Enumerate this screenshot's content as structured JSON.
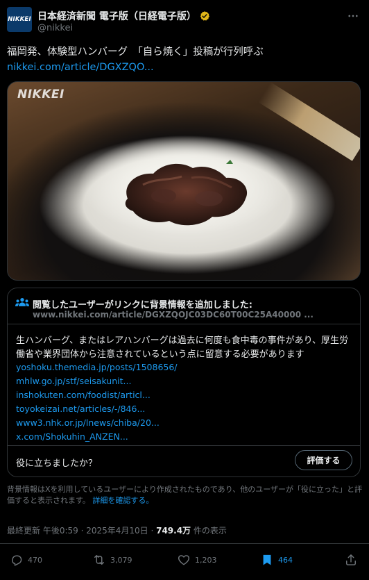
{
  "author": {
    "display_name": "日本経済新聞 電子版（日経電子版）",
    "handle": "@nikkei",
    "avatar_text": "NIKKEI"
  },
  "tweet": {
    "text": "福岡発、体験型ハンバーグ　「自ら焼く」投稿が行列呼ぶ",
    "link": "nikkei.com/article/DGXZQO..."
  },
  "media": {
    "logo_text": "NIKKEI",
    "icon": "photo-rice-bowl-with-hamburg"
  },
  "community_note": {
    "title": "閲覧したユーザーがリンクに背景情報を追加しました:",
    "url": "www.nikkei.com/article/DGXZQOJC03DC60T00C25A40000 ...",
    "body": "生ハンバーグ、またはレアハンバーグは過去に何度も食中毒の事件があり、厚生労働省や業界団体から注意されているという点に留意する必要があります",
    "sources": [
      "yoshoku.themedia.jp/posts/1508656/",
      "mhlw.go.jp/stf/seisakunit...",
      "inshokuten.com/foodist/articl...",
      "toyokeizai.net/articles/-/846...",
      "www3.nhk.or.jp/lnews/chiba/20...",
      "x.com/Shokuhin_ANZEN..."
    ],
    "helpful_question": "役に立ちましたか？",
    "rate_button": "評価する"
  },
  "disclaimer": {
    "text": "背景情報はXを利用しているユーザーにより作成されたものであり、他のユーザーが「役に立った」と評価すると表示されます。",
    "link": "詳細を確認する。"
  },
  "meta": {
    "time": "最終更新 午後0:59 · 2025年4月10日 · ",
    "views_count": "749.4万",
    "views_label": " 件の表示"
  },
  "actions": {
    "replies": "470",
    "retweets": "3,079",
    "likes": "1,203",
    "bookmarks": "464"
  },
  "colors": {
    "accent": "#1d9bf0",
    "verified": "#e2b719",
    "background": "#000000"
  }
}
